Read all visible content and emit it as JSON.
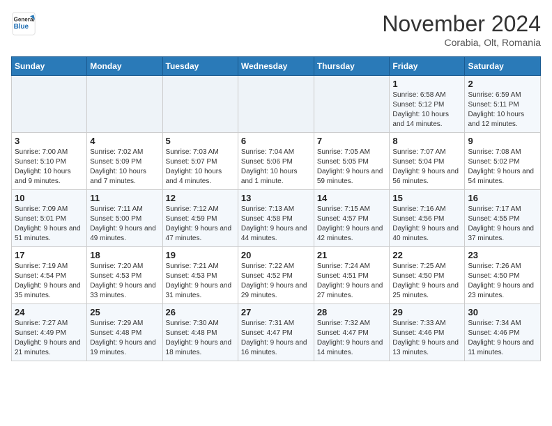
{
  "header": {
    "logo_line1": "General",
    "logo_line2": "Blue",
    "month": "November 2024",
    "location": "Corabia, Olt, Romania"
  },
  "weekdays": [
    "Sunday",
    "Monday",
    "Tuesday",
    "Wednesday",
    "Thursday",
    "Friday",
    "Saturday"
  ],
  "weeks": [
    [
      {
        "day": "",
        "info": ""
      },
      {
        "day": "",
        "info": ""
      },
      {
        "day": "",
        "info": ""
      },
      {
        "day": "",
        "info": ""
      },
      {
        "day": "",
        "info": ""
      },
      {
        "day": "1",
        "info": "Sunrise: 6:58 AM\nSunset: 5:12 PM\nDaylight: 10 hours and 14 minutes."
      },
      {
        "day": "2",
        "info": "Sunrise: 6:59 AM\nSunset: 5:11 PM\nDaylight: 10 hours and 12 minutes."
      }
    ],
    [
      {
        "day": "3",
        "info": "Sunrise: 7:00 AM\nSunset: 5:10 PM\nDaylight: 10 hours and 9 minutes."
      },
      {
        "day": "4",
        "info": "Sunrise: 7:02 AM\nSunset: 5:09 PM\nDaylight: 10 hours and 7 minutes."
      },
      {
        "day": "5",
        "info": "Sunrise: 7:03 AM\nSunset: 5:07 PM\nDaylight: 10 hours and 4 minutes."
      },
      {
        "day": "6",
        "info": "Sunrise: 7:04 AM\nSunset: 5:06 PM\nDaylight: 10 hours and 1 minute."
      },
      {
        "day": "7",
        "info": "Sunrise: 7:05 AM\nSunset: 5:05 PM\nDaylight: 9 hours and 59 minutes."
      },
      {
        "day": "8",
        "info": "Sunrise: 7:07 AM\nSunset: 5:04 PM\nDaylight: 9 hours and 56 minutes."
      },
      {
        "day": "9",
        "info": "Sunrise: 7:08 AM\nSunset: 5:02 PM\nDaylight: 9 hours and 54 minutes."
      }
    ],
    [
      {
        "day": "10",
        "info": "Sunrise: 7:09 AM\nSunset: 5:01 PM\nDaylight: 9 hours and 51 minutes."
      },
      {
        "day": "11",
        "info": "Sunrise: 7:11 AM\nSunset: 5:00 PM\nDaylight: 9 hours and 49 minutes."
      },
      {
        "day": "12",
        "info": "Sunrise: 7:12 AM\nSunset: 4:59 PM\nDaylight: 9 hours and 47 minutes."
      },
      {
        "day": "13",
        "info": "Sunrise: 7:13 AM\nSunset: 4:58 PM\nDaylight: 9 hours and 44 minutes."
      },
      {
        "day": "14",
        "info": "Sunrise: 7:15 AM\nSunset: 4:57 PM\nDaylight: 9 hours and 42 minutes."
      },
      {
        "day": "15",
        "info": "Sunrise: 7:16 AM\nSunset: 4:56 PM\nDaylight: 9 hours and 40 minutes."
      },
      {
        "day": "16",
        "info": "Sunrise: 7:17 AM\nSunset: 4:55 PM\nDaylight: 9 hours and 37 minutes."
      }
    ],
    [
      {
        "day": "17",
        "info": "Sunrise: 7:19 AM\nSunset: 4:54 PM\nDaylight: 9 hours and 35 minutes."
      },
      {
        "day": "18",
        "info": "Sunrise: 7:20 AM\nSunset: 4:53 PM\nDaylight: 9 hours and 33 minutes."
      },
      {
        "day": "19",
        "info": "Sunrise: 7:21 AM\nSunset: 4:53 PM\nDaylight: 9 hours and 31 minutes."
      },
      {
        "day": "20",
        "info": "Sunrise: 7:22 AM\nSunset: 4:52 PM\nDaylight: 9 hours and 29 minutes."
      },
      {
        "day": "21",
        "info": "Sunrise: 7:24 AM\nSunset: 4:51 PM\nDaylight: 9 hours and 27 minutes."
      },
      {
        "day": "22",
        "info": "Sunrise: 7:25 AM\nSunset: 4:50 PM\nDaylight: 9 hours and 25 minutes."
      },
      {
        "day": "23",
        "info": "Sunrise: 7:26 AM\nSunset: 4:50 PM\nDaylight: 9 hours and 23 minutes."
      }
    ],
    [
      {
        "day": "24",
        "info": "Sunrise: 7:27 AM\nSunset: 4:49 PM\nDaylight: 9 hours and 21 minutes."
      },
      {
        "day": "25",
        "info": "Sunrise: 7:29 AM\nSunset: 4:48 PM\nDaylight: 9 hours and 19 minutes."
      },
      {
        "day": "26",
        "info": "Sunrise: 7:30 AM\nSunset: 4:48 PM\nDaylight: 9 hours and 18 minutes."
      },
      {
        "day": "27",
        "info": "Sunrise: 7:31 AM\nSunset: 4:47 PM\nDaylight: 9 hours and 16 minutes."
      },
      {
        "day": "28",
        "info": "Sunrise: 7:32 AM\nSunset: 4:47 PM\nDaylight: 9 hours and 14 minutes."
      },
      {
        "day": "29",
        "info": "Sunrise: 7:33 AM\nSunset: 4:46 PM\nDaylight: 9 hours and 13 minutes."
      },
      {
        "day": "30",
        "info": "Sunrise: 7:34 AM\nSunset: 4:46 PM\nDaylight: 9 hours and 11 minutes."
      }
    ]
  ]
}
